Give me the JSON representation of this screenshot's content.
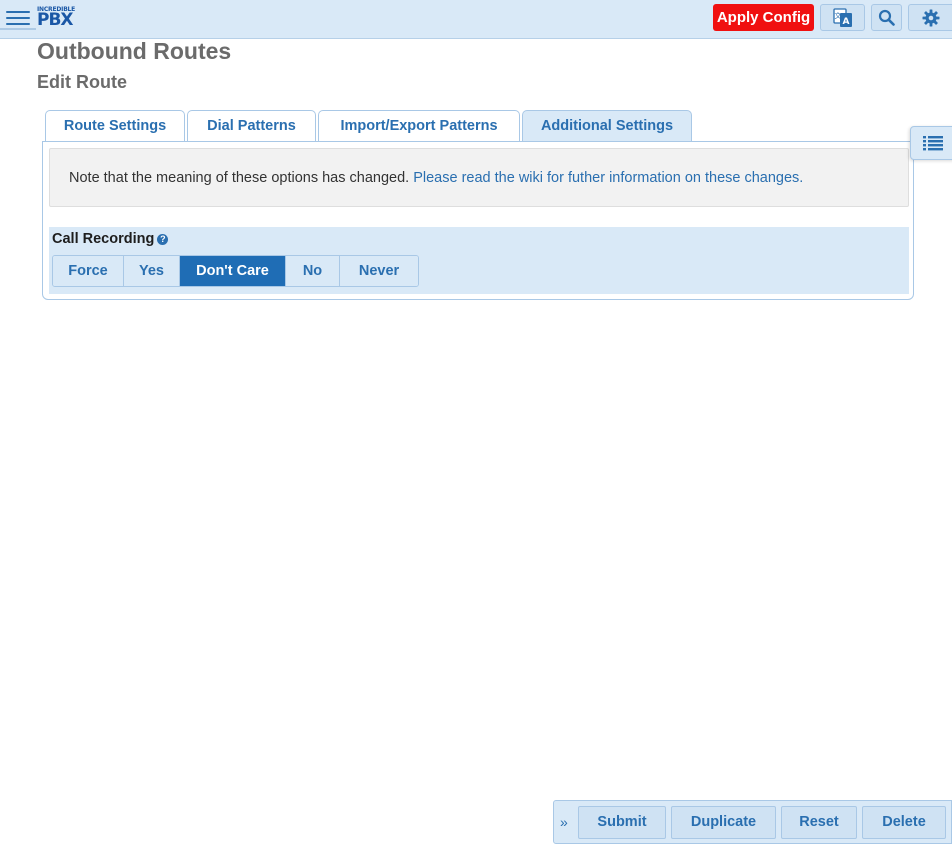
{
  "header": {
    "logo_small": "INCREDIBLE",
    "logo_main": "PBX",
    "apply_config_label": "Apply Config",
    "icons": [
      "menu-icon",
      "translate-icon",
      "search-icon",
      "gear-icon"
    ]
  },
  "page": {
    "title": "Outbound Routes",
    "subtitle": "Edit Route"
  },
  "tabs": [
    {
      "label": "Route Settings",
      "active": false
    },
    {
      "label": "Dial Patterns",
      "active": false
    },
    {
      "label": "Import/Export Patterns",
      "active": false
    },
    {
      "label": "Additional Settings",
      "active": true
    }
  ],
  "note": {
    "text": "Note that the meaning of these options has changed.",
    "link_text": "Please read the wiki for futher information on these changes."
  },
  "call_recording": {
    "label": "Call Recording",
    "help_glyph": "?",
    "options": [
      "Force",
      "Yes",
      "Don't Care",
      "No",
      "Never"
    ],
    "selected": "Don't Care"
  },
  "action_bar": {
    "toggle_glyph": "»",
    "submit_label": "Submit",
    "duplicate_label": "Duplicate",
    "reset_label": "Reset",
    "delete_label": "Delete"
  },
  "colors": {
    "accent": "#2a6fb0",
    "header_bg": "#d9e9f7",
    "apply_bg": "#f01010",
    "selected_bg": "#1f6db5"
  }
}
